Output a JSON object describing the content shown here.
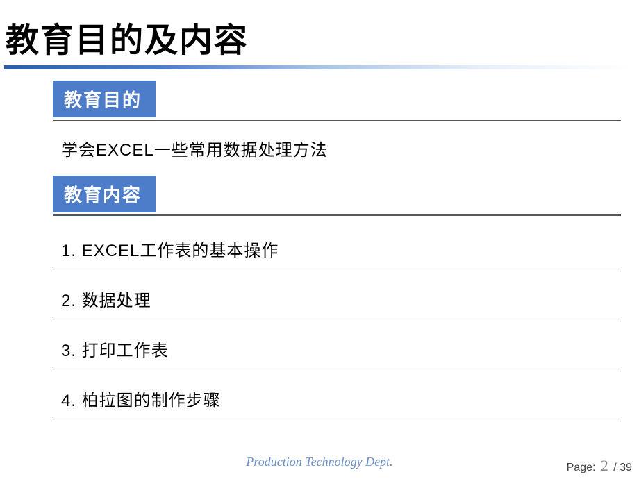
{
  "title": "教育目的及内容",
  "sections": {
    "purpose": {
      "label": "教育目的",
      "text": "学会EXCEL一些常用数据处理方法"
    },
    "content": {
      "label": "教育内容",
      "items": [
        "1. EXCEL工作表的基本操作",
        "2. 数据处理",
        "3. 打印工作表",
        "4. 柏拉图的制作步骤"
      ]
    }
  },
  "footer": {
    "department": "Production Technology Dept.",
    "page_label": "Page:",
    "page_current": "2",
    "page_sep": " / ",
    "page_total": "39"
  }
}
